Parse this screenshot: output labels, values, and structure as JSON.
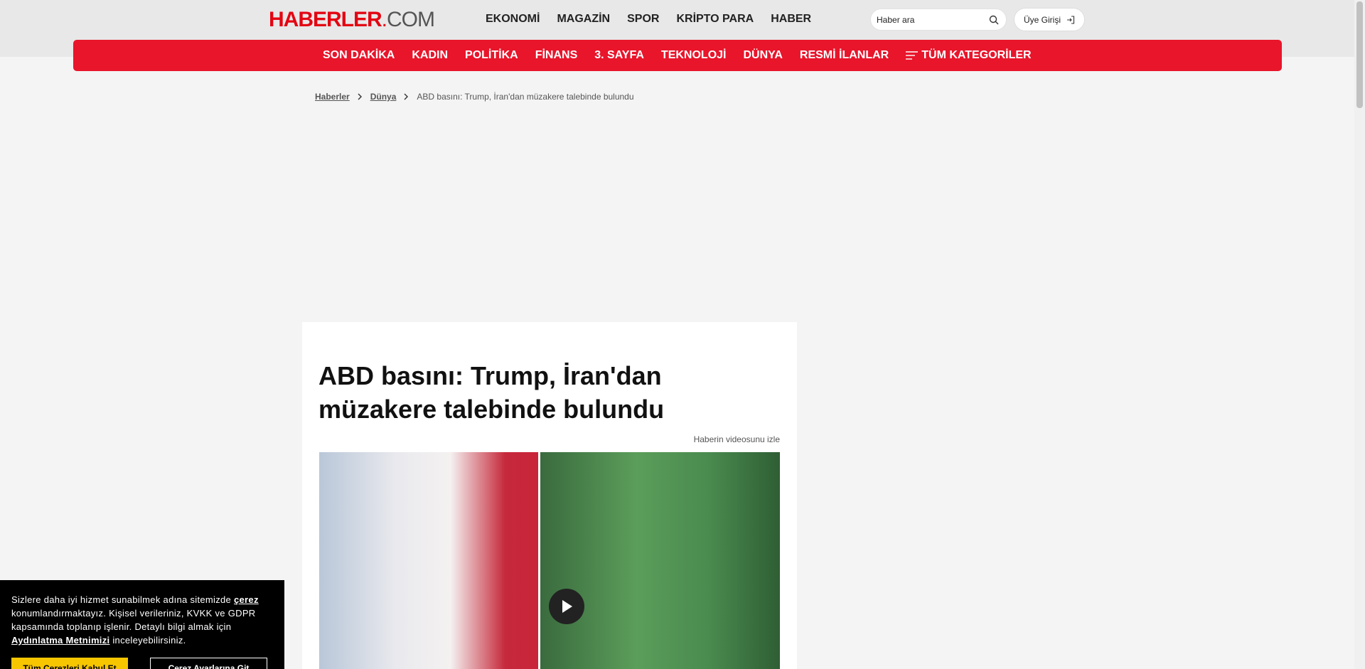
{
  "header": {
    "logo": {
      "main": "HABERLER",
      "dot": ".",
      "com": "COM"
    },
    "top_nav": [
      "EKONOMİ",
      "MAGAZİN",
      "SPOR",
      "KRİPTO PARA",
      "HABER"
    ],
    "search_placeholder": "Haber ara",
    "login_label": "Üye Girişi"
  },
  "category_nav": {
    "items": [
      "SON DAKİKA",
      "KADIN",
      "POLİTİKA",
      "FİNANS",
      "3. SAYFA",
      "TEKNOLOJİ",
      "DÜNYA",
      "RESMİ İLANLAR"
    ],
    "all_categories": "TÜM KATEGORİLER"
  },
  "breadcrumb": {
    "home": "Haberler",
    "section": "Dünya",
    "current": "ABD basını: Trump, İran'dan müzakere talebinde bulundu"
  },
  "article": {
    "title": "ABD basını: Trump, İran'dan müzakere talebinde bulundu",
    "video_link": "Haberin videosunu izle"
  },
  "cookie": {
    "text_1": "Sizlere daha iyi hizmet sunabilmek adına sitemizde ",
    "link_cerez": "çerez",
    "text_2": " konumlandırmaktayız. Kişisel verileriniz, KVKK ve GDPR kapsamında toplanıp işlenir. Detaylı bilgi almak için ",
    "link_aydinlatma": "Aydınlatma Metnimizi",
    "text_3": " inceleyebilirsiniz.",
    "accept_label": "Tüm Çerezleri Kabul Et",
    "settings_label": "Çerez Ayarlarına Git"
  },
  "colors": {
    "brand_red": "#e8152b",
    "accent_yellow": "#f7c600"
  }
}
